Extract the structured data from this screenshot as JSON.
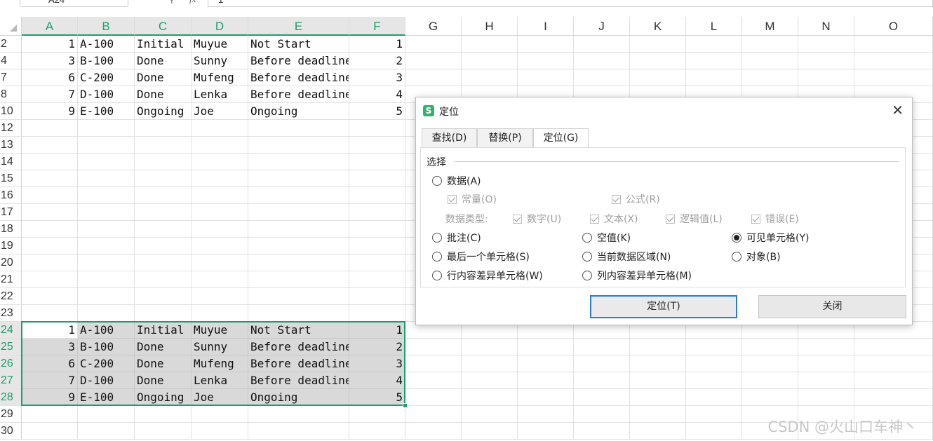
{
  "formula_bar": {
    "cell_ref": "A24",
    "fx_label": "fx",
    "value": "1"
  },
  "columns": [
    "A",
    "B",
    "C",
    "D",
    "E",
    "F",
    "G",
    "H",
    "I",
    "J",
    "K",
    "L",
    "M",
    "N",
    "O"
  ],
  "selected_columns": [
    "A",
    "B",
    "C",
    "D",
    "E",
    "F"
  ],
  "rows": [
    {
      "num": "2",
      "cells": [
        "1",
        "A-100",
        "Initial",
        "Muyue",
        "Not Start",
        "1"
      ]
    },
    {
      "num": "4",
      "cells": [
        "3",
        "B-100",
        "Done",
        "Sunny",
        "Before deadline",
        "2"
      ]
    },
    {
      "num": "7",
      "cells": [
        "6",
        "C-200",
        "Done",
        "Mufeng",
        "Before deadline",
        "3"
      ]
    },
    {
      "num": "8",
      "cells": [
        "7",
        "D-100",
        "Done",
        "Lenka",
        "Before deadline",
        "4"
      ]
    },
    {
      "num": "10",
      "cells": [
        "9",
        "E-100",
        "Ongoing",
        "Joe",
        "Ongoing",
        "5"
      ]
    },
    {
      "num": "12",
      "cells": [
        "",
        "",
        "",
        "",
        "",
        ""
      ]
    },
    {
      "num": "13",
      "cells": [
        "",
        "",
        "",
        "",
        "",
        ""
      ]
    },
    {
      "num": "14",
      "cells": [
        "",
        "",
        "",
        "",
        "",
        ""
      ]
    },
    {
      "num": "15",
      "cells": [
        "",
        "",
        "",
        "",
        "",
        ""
      ]
    },
    {
      "num": "16",
      "cells": [
        "",
        "",
        "",
        "",
        "",
        ""
      ]
    },
    {
      "num": "17",
      "cells": [
        "",
        "",
        "",
        "",
        "",
        ""
      ]
    },
    {
      "num": "18",
      "cells": [
        "",
        "",
        "",
        "",
        "",
        ""
      ]
    },
    {
      "num": "19",
      "cells": [
        "",
        "",
        "",
        "",
        "",
        ""
      ]
    },
    {
      "num": "20",
      "cells": [
        "",
        "",
        "",
        "",
        "",
        ""
      ]
    },
    {
      "num": "21",
      "cells": [
        "",
        "",
        "",
        "",
        "",
        ""
      ]
    },
    {
      "num": "22",
      "cells": [
        "",
        "",
        "",
        "",
        "",
        ""
      ]
    },
    {
      "num": "23",
      "cells": [
        "",
        "",
        "",
        "",
        "",
        ""
      ]
    },
    {
      "num": "24",
      "cells": [
        "1",
        "A-100",
        "Initial",
        "Muyue",
        "Not Start",
        "1"
      ],
      "selected": true
    },
    {
      "num": "25",
      "cells": [
        "3",
        "B-100",
        "Done",
        "Sunny",
        "Before deadline",
        "2"
      ],
      "selected": true
    },
    {
      "num": "26",
      "cells": [
        "6",
        "C-200",
        "Done",
        "Mufeng",
        "Before deadline",
        "3"
      ],
      "selected": true
    },
    {
      "num": "27",
      "cells": [
        "7",
        "D-100",
        "Done",
        "Lenka",
        "Before deadline",
        "4"
      ],
      "selected": true
    },
    {
      "num": "28",
      "cells": [
        "9",
        "E-100",
        "Ongoing",
        "Joe",
        "Ongoing",
        "5"
      ],
      "selected": true
    },
    {
      "num": "29",
      "cells": [
        "",
        "",
        "",
        "",
        "",
        ""
      ]
    },
    {
      "num": "30",
      "cells": [
        "",
        "",
        "",
        "",
        "",
        ""
      ]
    }
  ],
  "watermark": "CSDN @火山口车神丶",
  "dialog": {
    "icon": "S",
    "title": "定位",
    "close": "✕",
    "tabs": [
      "查找(D)",
      "替换(P)",
      "定位(G)"
    ],
    "active_tab": "定位(G)",
    "group_label": "选择",
    "options": {
      "data": "数据(A)",
      "constant": "常量(O)",
      "formula": "公式(R)",
      "data_type_label": "数据类型:",
      "number": "数字(U)",
      "text": "文本(X)",
      "logical": "逻辑值(L)",
      "error": "错误(E)",
      "comment": "批注(C)",
      "blank": "空值(K)",
      "visible_cells": "可见单元格(Y)",
      "last_cell": "最后一个单元格(S)",
      "current_region": "当前数据区域(N)",
      "objects": "对象(B)",
      "row_diff": "行内容差异单元格(W)",
      "col_diff": "列内容差异单元格(M)"
    },
    "selected_option": "可见单元格(Y)",
    "buttons": {
      "goto": "定位(T)",
      "close": "关闭"
    }
  },
  "colors": {
    "accent": "#1e9e6a",
    "selection_fill": "#d9d9d9",
    "button_focus": "#2b7cd3"
  }
}
